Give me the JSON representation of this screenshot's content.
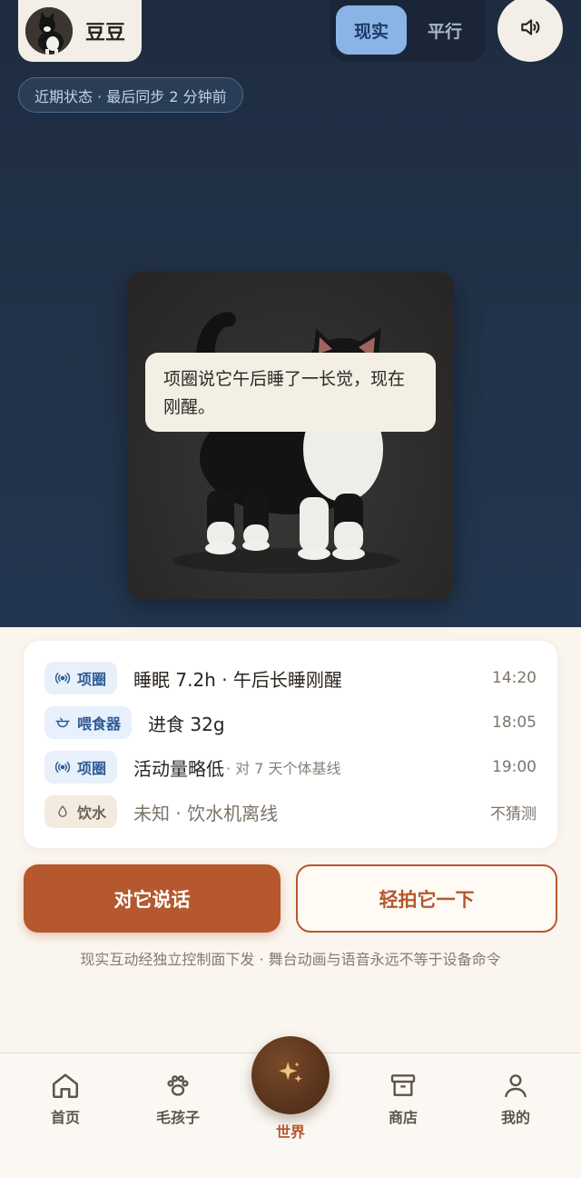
{
  "header": {
    "pet_name": "豆豆",
    "mode_options": [
      "现实",
      "平行"
    ],
    "mode_active": "现实",
    "sound_icon": "speaker-icon",
    "status_text": "近期状态 · 最后同步 2 分钟前"
  },
  "stage": {
    "speech": "项圈说它午后睡了一长觉，现在刚醒。"
  },
  "events": [
    {
      "source": "项圈",
      "icon": "signal-icon",
      "tone": "blue",
      "text": "睡眠 7.2h · 午后长睡刚醒",
      "sub": "",
      "time": "14:20"
    },
    {
      "source": "喂食器",
      "icon": "bowl-icon",
      "tone": "blue",
      "text": "进食 32g",
      "sub": "",
      "time": "18:05"
    },
    {
      "source": "项圈",
      "icon": "signal-icon",
      "tone": "blue",
      "text": "活动量略低",
      "sub": "· 对 7 天个体基线",
      "time": "19:00"
    },
    {
      "source": "饮水",
      "icon": "drop-icon",
      "tone": "beige",
      "text": "未知 · 饮水机离线",
      "sub": "",
      "time": "不猜测"
    }
  ],
  "actions": {
    "talk": "对它说话",
    "pat": "轻拍它一下",
    "disclaimer": "现实互动经独立控制面下发 · 舞台动画与语音永远不等于设备命令"
  },
  "tabs": [
    {
      "label": "首页",
      "icon": "home-icon"
    },
    {
      "label": "毛孩子",
      "icon": "paw-icon"
    },
    {
      "label": "世界",
      "icon": "sparkle-icon",
      "active": true
    },
    {
      "label": "商店",
      "icon": "store-icon"
    },
    {
      "label": "我的",
      "icon": "user-icon"
    }
  ],
  "colors": {
    "accent": "#b5582e",
    "stage_bg": "#1e2c41",
    "mode_active_bg": "#8bb4e6",
    "tag_blue": "#2c5b95"
  }
}
